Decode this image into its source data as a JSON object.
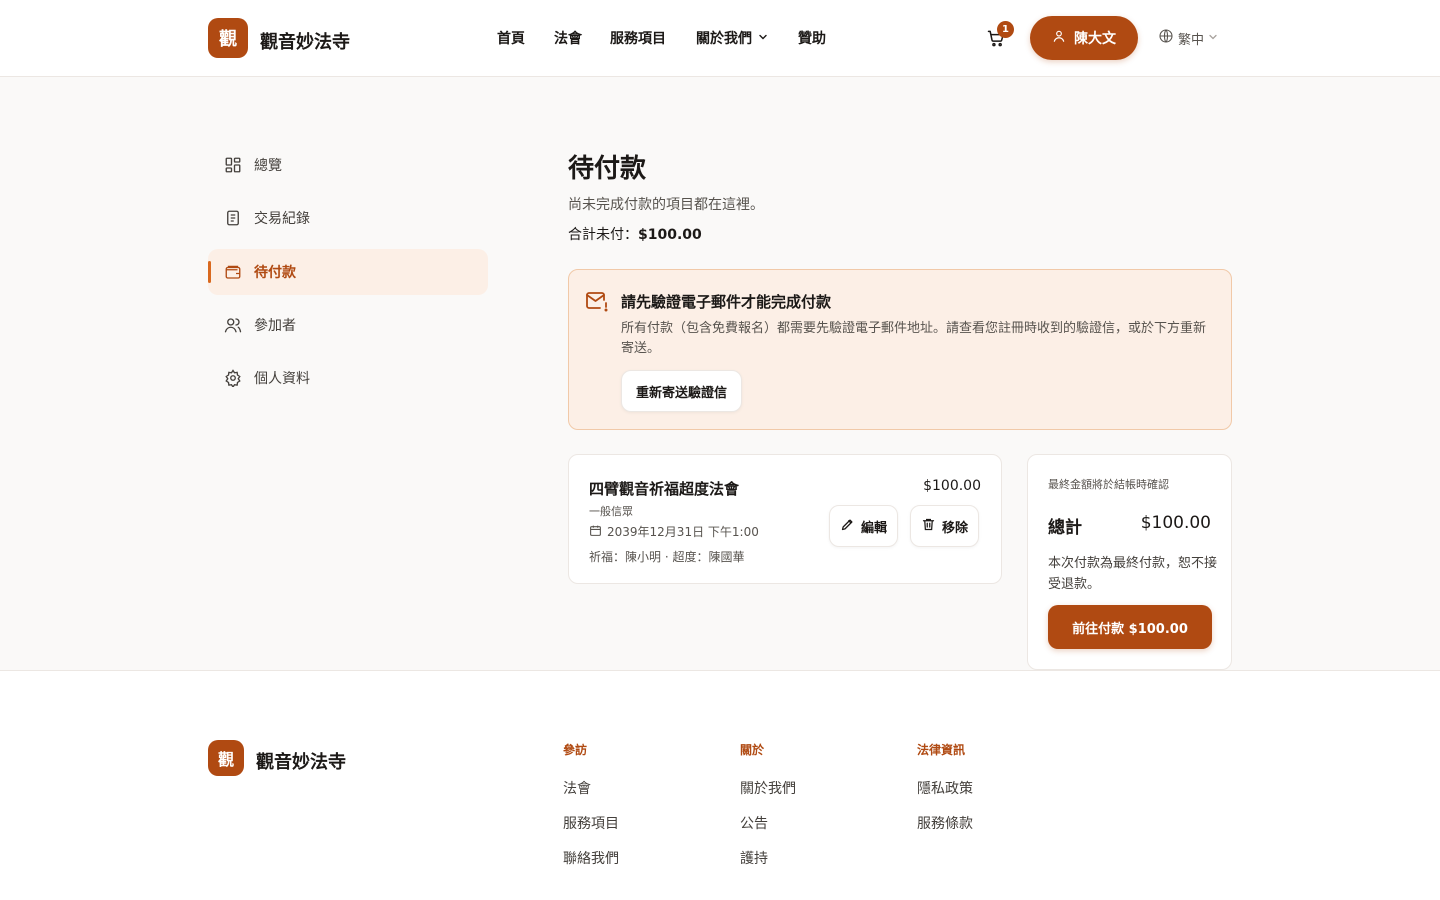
{
  "header": {
    "logo_mark": "觀",
    "logo_text": "觀音妙法寺",
    "nav": [
      "首頁",
      "法會",
      "服務項目",
      "關於我們",
      "贊助"
    ],
    "cart_count": "1",
    "user_name": "陳大文",
    "language": "繁中"
  },
  "sidebar": {
    "items": [
      {
        "label": "總覽",
        "icon": "grid-icon"
      },
      {
        "label": "交易紀錄",
        "icon": "document-icon"
      },
      {
        "label": "待付款",
        "icon": "wallet-icon"
      },
      {
        "label": "參加者",
        "icon": "users-icon"
      },
      {
        "label": "個人資料",
        "icon": "gear-icon"
      }
    ],
    "active_index": 2
  },
  "main": {
    "title": "待付款",
    "subtitle": "尚未完成付款的項目都在這裡。",
    "total_label": "合計未付：",
    "total_value": "$100.00",
    "alert": {
      "title": "請先驗證電子郵件才能完成付款",
      "body": "所有付款（包含免費報名）都需要先驗證電子郵件地址。請查看您註冊時收到的驗證信，或於下方重新寄送。",
      "button": "重新寄送驗證信"
    },
    "item": {
      "title": "四臂觀音祈福超度法會",
      "price": "$100.00",
      "category": "一般信眾",
      "date": "2039年12月31日 下午1:00",
      "names": "祈福：陳小明 · 超度：陳國華",
      "edit_label": "編輯",
      "remove_label": "移除"
    },
    "summary": {
      "note": "最終金額將於結帳時確認",
      "label": "總計",
      "value": "$100.00",
      "warning": "本次付款為最終付款，恕不接受退款。",
      "pay_button": "前往付款 $100.00"
    }
  },
  "footer": {
    "logo_mark": "觀",
    "logo_text": "觀音妙法寺",
    "columns": [
      {
        "heading": "參訪",
        "links": [
          "法會",
          "服務項目",
          "聯絡我們"
        ]
      },
      {
        "heading": "關於",
        "links": [
          "關於我們",
          "公告",
          "護持"
        ]
      },
      {
        "heading": "法律資訊",
        "links": [
          "隱私政策",
          "服務條款"
        ]
      }
    ]
  },
  "colors": {
    "brand": "#b04a12",
    "alert_bg": "#fcefe6",
    "alert_border": "#f1c9a8"
  }
}
